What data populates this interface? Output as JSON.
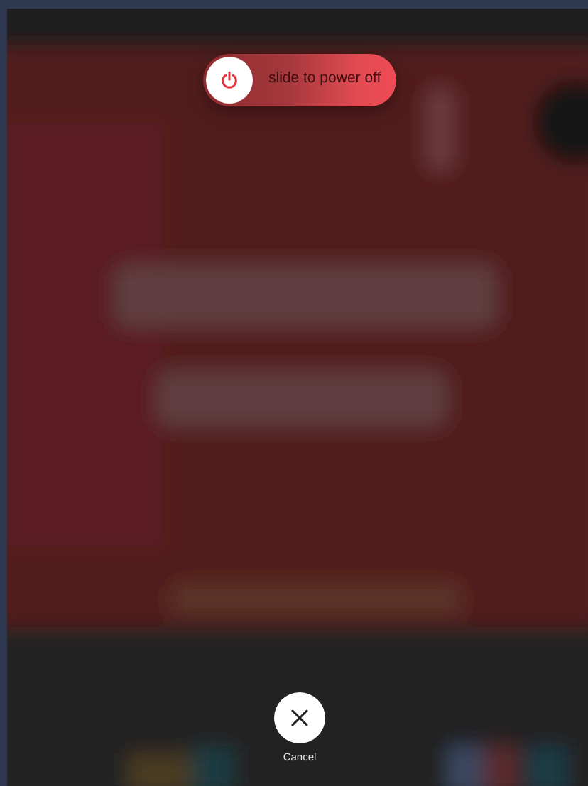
{
  "power_slider": {
    "label": "slide to power off",
    "level": 0
  },
  "cancel_button": {
    "label": "Cancel"
  }
}
